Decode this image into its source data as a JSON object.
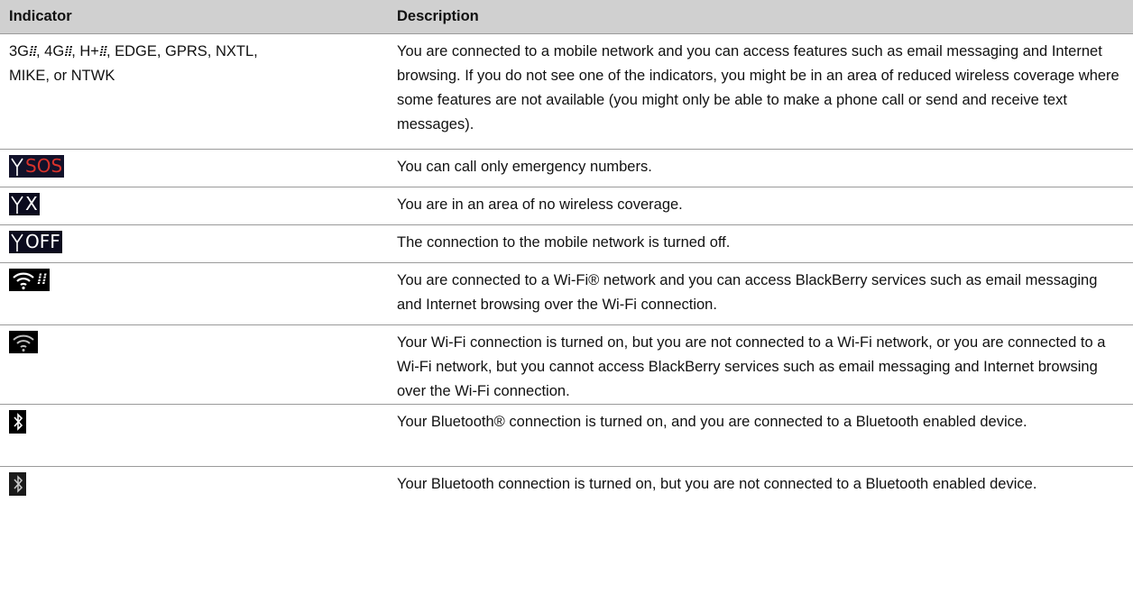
{
  "header": {
    "indicator": "Indicator",
    "description": "Description"
  },
  "rows": [
    {
      "indicator_parts": [
        "3G",
        "",
        ", 4G",
        "",
        ", H+",
        "",
        ", EDGE, GPRS, NXTL,",
        "MIKE, or NTWK"
      ],
      "description": "You are connected to a mobile network and you can access features such as email messaging and Internet browsing. If you do not see one of the indicators, you might be in an area of reduced wireless coverage where some features are not available (you might only be able to make a phone call or send and receive text messages)."
    },
    {
      "icon": "antenna-sos-icon",
      "icon_text": "SOS",
      "description": "You can call only emergency numbers."
    },
    {
      "icon": "antenna-x-icon",
      "icon_text": "X",
      "description": "You are in an area of no wireless coverage."
    },
    {
      "icon": "antenna-off-icon",
      "icon_text": "OFF",
      "description": "The connection to the mobile network is turned off."
    },
    {
      "icon": "wifi-blackberry-icon",
      "description": "You are connected to a Wi-Fi® network and you can access BlackBerry services such as email messaging and Internet browsing over the Wi-Fi connection."
    },
    {
      "icon": "wifi-icon",
      "description": "Your Wi-Fi connection is turned on, but you are not connected to a Wi-Fi network, or you are connected to a Wi-Fi network, but you cannot access BlackBerry services such as email messaging and Internet browsing over the Wi-Fi connection."
    },
    {
      "icon": "bluetooth-connected-icon",
      "description": "Your Bluetooth® connection is turned on, and you are connected to a Bluetooth enabled device."
    },
    {
      "icon": "bluetooth-icon",
      "description": "Your Bluetooth connection is turned on, but you are not connected to a Bluetooth enabled device."
    }
  ],
  "colors": {
    "header_bg": "#d0d0d0",
    "sos_red": "#d8322b",
    "icon_bg": "#0b0b1e"
  }
}
